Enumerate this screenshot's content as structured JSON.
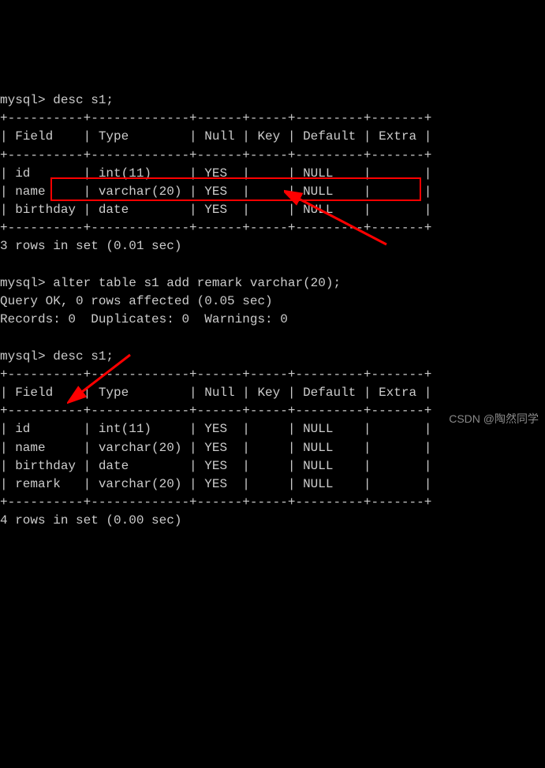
{
  "prompt1": "mysql> ",
  "cmd1": "desc s1;",
  "table1": {
    "border_top": "+----------+-------------+------+-----+---------+-------+",
    "header": "| Field    | Type        | Null | Key | Default | Extra |",
    "border_header": "+----------+-------------+------+-----+---------+-------+",
    "rows": [
      "| id       | int(11)     | YES  |     | NULL    |       |",
      "| name     | varchar(20) | YES  |     | NULL    |       |",
      "| birthday | date        | YES  |     | NULL    |       |"
    ],
    "border_bottom": "+----------+-------------+------+-----+---------+-------+"
  },
  "result1": "3 rows in set (0.01 sec)",
  "prompt2": "mysql> ",
  "cmd2": "alter table s1 add remark varchar(20);",
  "result2_line1": "Query OK, 0 rows affected (0.05 sec)",
  "result2_line2": "Records: 0  Duplicates: 0  Warnings: 0",
  "prompt3": "mysql> ",
  "cmd3": "desc s1;",
  "table2": {
    "border_top": "+----------+-------------+------+-----+---------+-------+",
    "header": "| Field    | Type        | Null | Key | Default | Extra |",
    "border_header": "+----------+-------------+------+-----+---------+-------+",
    "rows": [
      "| id       | int(11)     | YES  |     | NULL    |       |",
      "| name     | varchar(20) | YES  |     | NULL    |       |",
      "| birthday | date        | YES  |     | NULL    |       |",
      "| remark   | varchar(20) | YES  |     | NULL    |       |"
    ],
    "border_bottom": "+----------+-------------+------+-----+---------+-------+"
  },
  "result3": "4 rows in set (0.00 sec)",
  "watermark": "CSDN @陶然同学",
  "chart_data": {
    "type": "table",
    "tables": [
      {
        "title": "desc s1 (before alter)",
        "columns": [
          "Field",
          "Type",
          "Null",
          "Key",
          "Default",
          "Extra"
        ],
        "rows": [
          [
            "id",
            "int(11)",
            "YES",
            "",
            "NULL",
            ""
          ],
          [
            "name",
            "varchar(20)",
            "YES",
            "",
            "NULL",
            ""
          ],
          [
            "birthday",
            "date",
            "YES",
            "",
            "NULL",
            ""
          ]
        ]
      },
      {
        "title": "desc s1 (after alter)",
        "columns": [
          "Field",
          "Type",
          "Null",
          "Key",
          "Default",
          "Extra"
        ],
        "rows": [
          [
            "id",
            "int(11)",
            "YES",
            "",
            "NULL",
            ""
          ],
          [
            "name",
            "varchar(20)",
            "YES",
            "",
            "NULL",
            ""
          ],
          [
            "birthday",
            "date",
            "YES",
            "",
            "NULL",
            ""
          ],
          [
            "remark",
            "varchar(20)",
            "YES",
            "",
            "NULL",
            ""
          ]
        ]
      }
    ]
  }
}
